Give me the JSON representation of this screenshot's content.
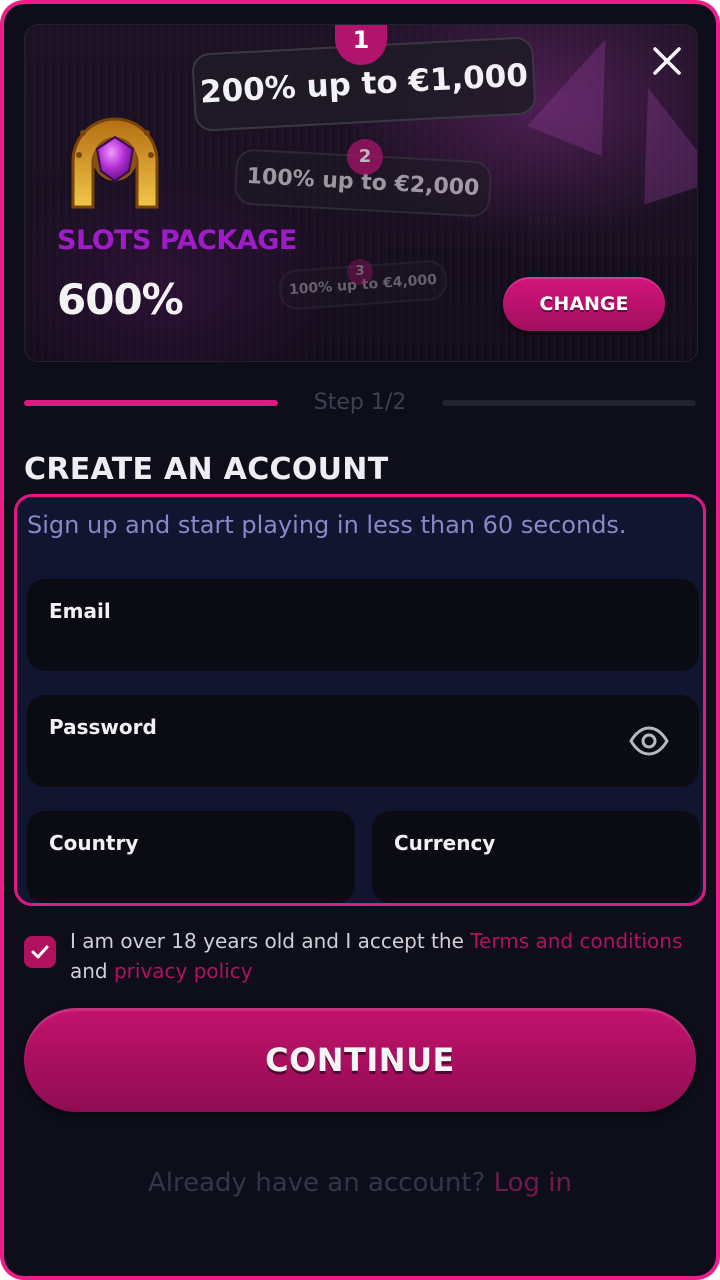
{
  "banner": {
    "offers": [
      {
        "step": "1",
        "label": "200% up to €1,000"
      },
      {
        "step": "2",
        "label": "100% up to €2,000"
      },
      {
        "step": "3",
        "label": "100% up to €4,000"
      }
    ],
    "package_name": "SLOTS PACKAGE",
    "package_percent": "600%",
    "change_label": "CHANGE"
  },
  "steps": {
    "label": "Step 1/2",
    "current": 1,
    "total": 2
  },
  "form": {
    "title": "CREATE AN ACCOUNT",
    "subtitle": "Sign up and start playing in less than 60 seconds.",
    "email_label": "Email",
    "email_value": "",
    "password_label": "Password",
    "password_value": "",
    "country_label": "Country",
    "currency_label": "Currency"
  },
  "terms": {
    "checked": true,
    "text_before": "I am over 18 years old and I accept the ",
    "terms_link": "Terms and conditions",
    "text_middle": " and ",
    "privacy_link": "privacy policy"
  },
  "continue_label": "CONTINUE",
  "login": {
    "question": "Already have an account? ",
    "link": "Log in"
  },
  "colors": {
    "accent": "#e0187f",
    "package_name": "#a11cc9",
    "background": "#0e0e1b",
    "field": "#0b0b14"
  }
}
